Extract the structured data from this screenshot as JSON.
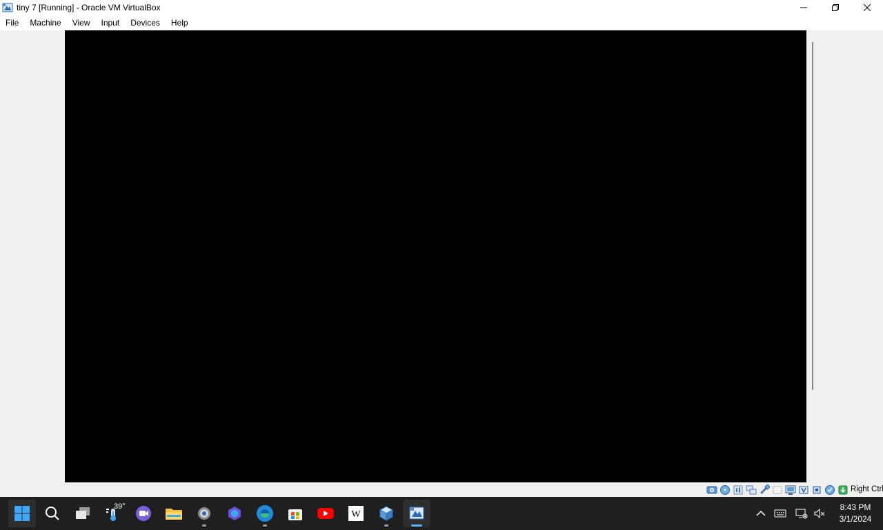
{
  "window": {
    "title": "tiny 7 [Running] - Oracle VM VirtualBox"
  },
  "menu": {
    "items": [
      "File",
      "Machine",
      "View",
      "Input",
      "Devices",
      "Help"
    ]
  },
  "statusbar": {
    "icons": [
      "hard-disk-icon",
      "optical-drive-icon",
      "audio-icon",
      "network-icon",
      "usb-icon",
      "shared-folders-icon",
      "display-icon",
      "recording-icon",
      "cpu-icon",
      "mouse-integration-icon",
      "keyboard-capture-icon"
    ],
    "host_key": "Right Ctrl"
  },
  "taskbar": {
    "weather_temp": "39°",
    "apps": [
      "start",
      "search",
      "task-view",
      "weather",
      "video-call",
      "file-explorer",
      "settings",
      "copilot",
      "edge",
      "store",
      "youtube",
      "wikipedia",
      "virtualbox",
      "virtualbox-vm"
    ],
    "clock": {
      "time": "8:43 PM",
      "date": "3/1/2024"
    }
  },
  "colors": {
    "titlebar": "#ffffff",
    "background": "#f0f0f0",
    "vm_screen": "#000000",
    "taskbar": "#1f1f1f"
  }
}
